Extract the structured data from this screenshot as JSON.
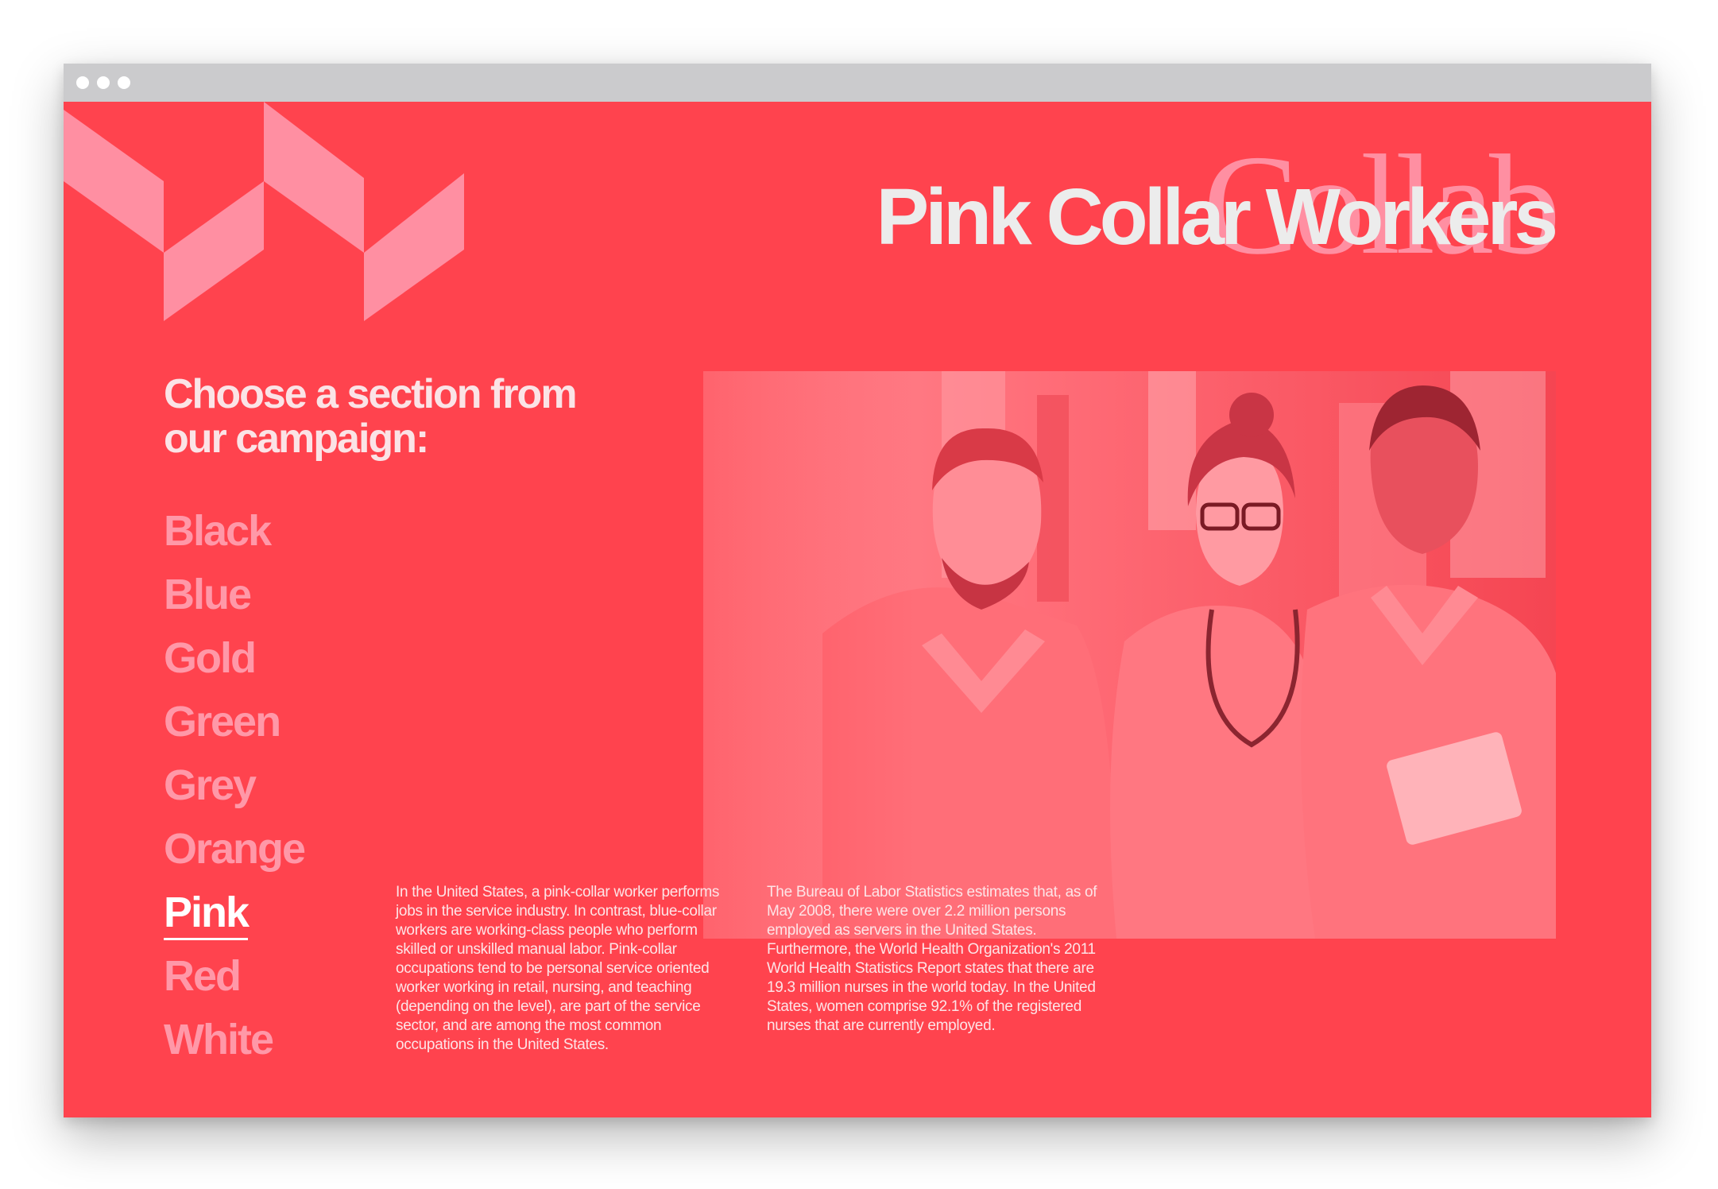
{
  "window": {
    "controls": [
      "close-dot",
      "minimize-dot",
      "maximize-dot"
    ]
  },
  "colors": {
    "background": "#ff434e",
    "logo": "#ff8fa2",
    "title": "#ececec",
    "nav_inactive": "#ff98a8",
    "nav_active": "#ffffff"
  },
  "header": {
    "title": "Pink Collar Workers",
    "watermark": "Collab"
  },
  "campaign": {
    "prompt": "Choose a section from our campaign:",
    "sections": [
      {
        "label": "Black",
        "active": false
      },
      {
        "label": "Blue",
        "active": false
      },
      {
        "label": "Gold",
        "active": false
      },
      {
        "label": "Green",
        "active": false
      },
      {
        "label": "Grey",
        "active": false
      },
      {
        "label": "Orange",
        "active": false
      },
      {
        "label": "Pink",
        "active": true
      },
      {
        "label": "Red",
        "active": false
      },
      {
        "label": "White",
        "active": false
      }
    ]
  },
  "content": {
    "paragraph1": "In the United States, a pink-collar worker performs jobs in the service industry. In contrast, blue-collar workers are working-class people who perform skilled or unskilled manual labor. Pink-collar occupations tend to be personal service oriented worker working in retail, nursing, and teaching (depending on the level), are part of the service sector, and are among the most common occupations in the United States.",
    "paragraph2": "The Bureau of Labor Statistics estimates that, as of May 2008, there were over 2.2 million persons employed as servers in the United States. Furthermore, the World Health Organization's 2011 World Health Statistics Report states that there are 19.3 million nurses in the world today. In the United States, women comprise 92.1% of the registered nurses that are currently employed."
  }
}
